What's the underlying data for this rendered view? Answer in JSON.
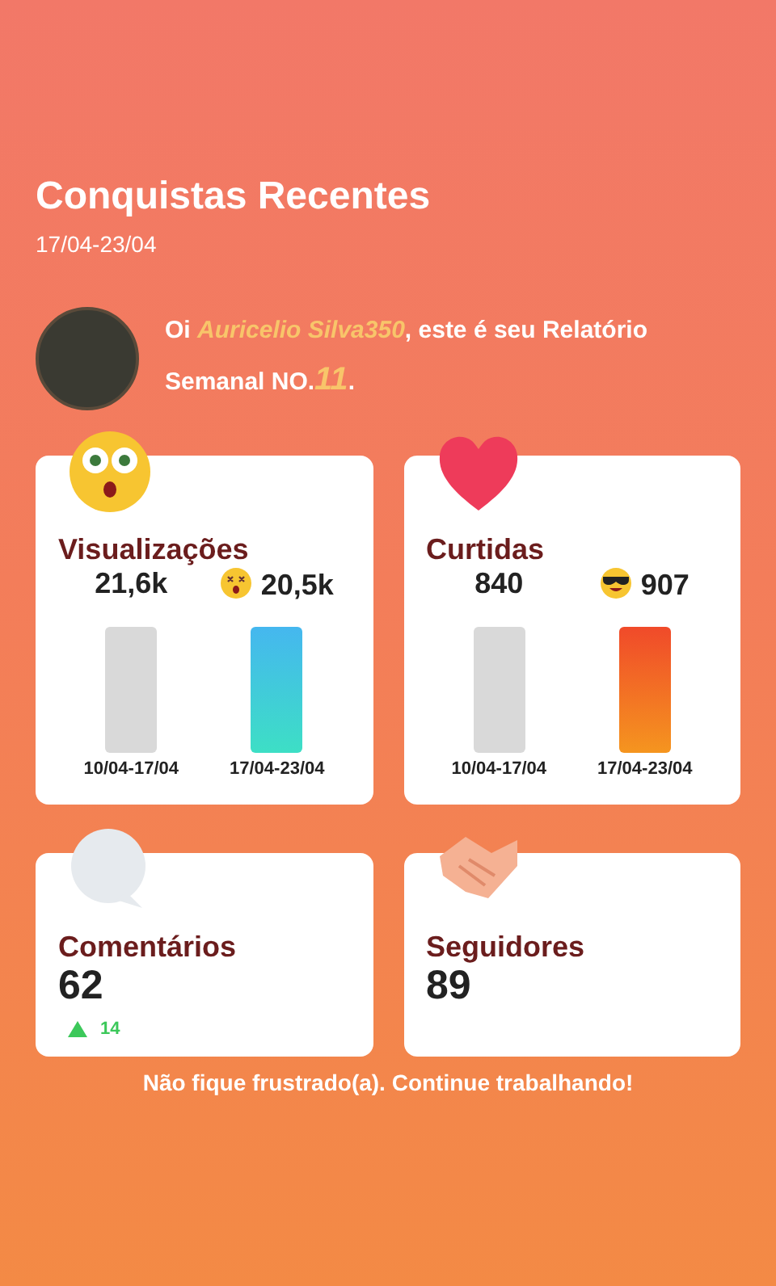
{
  "header": {
    "title": "Conquistas Recentes",
    "date_range": "17/04-23/04"
  },
  "greeting": {
    "prefix": "Oi ",
    "user_name": "Auricelio Silva350",
    "middle": ", este é seu Relatório Semanal NO.",
    "report_number": "11",
    "suffix": "."
  },
  "cards": [
    {
      "kind": "comparison",
      "title": "Visualizações",
      "previous": {
        "value": "21,6k",
        "period": "10/04-17/04"
      },
      "current": {
        "value": "20,5k",
        "period": "17/04-23/04"
      }
    },
    {
      "kind": "comparison",
      "title": "Curtidas",
      "previous": {
        "value": "840",
        "period": "10/04-17/04"
      },
      "current": {
        "value": "907",
        "period": "17/04-23/04"
      }
    },
    {
      "kind": "count",
      "title": "Comentários",
      "value": "62",
      "change": "14"
    },
    {
      "kind": "count",
      "title": "Seguidores",
      "value": "89"
    }
  ],
  "footer": "Não fique frustrado(a). Continue trabalhando!"
}
